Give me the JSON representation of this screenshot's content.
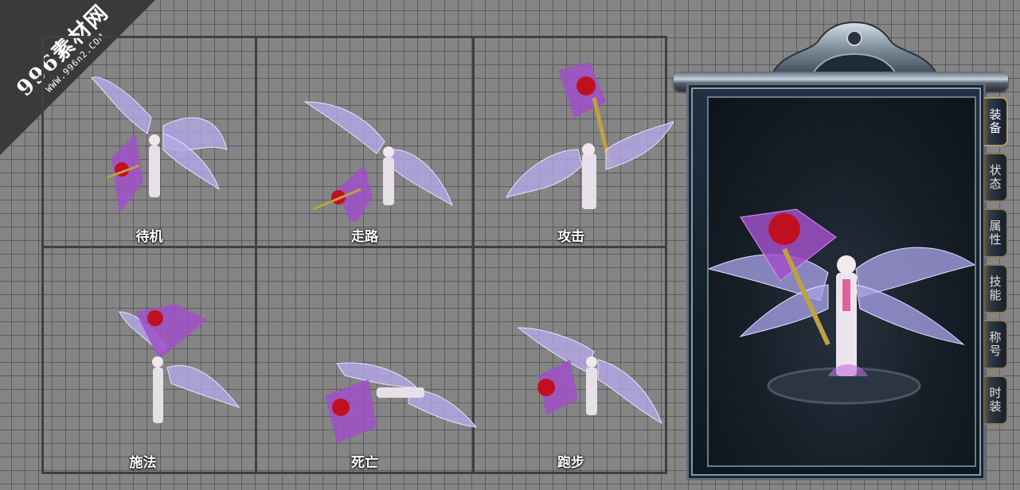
{
  "watermark": {
    "main": "996素材网",
    "sub": "WWW.996n2.COM"
  },
  "frames": [
    {
      "label": "待机"
    },
    {
      "label": "走路"
    },
    {
      "label": "攻击"
    },
    {
      "label": "施法"
    },
    {
      "label": "死亡"
    },
    {
      "label": "跑步"
    }
  ],
  "equipment_panel": {
    "tabs": [
      {
        "label": "装备",
        "active": true
      },
      {
        "label": "状态",
        "active": false
      },
      {
        "label": "属性",
        "active": false
      },
      {
        "label": "技能",
        "active": false
      },
      {
        "label": "称号",
        "active": false
      },
      {
        "label": "时装",
        "active": false
      }
    ]
  }
}
